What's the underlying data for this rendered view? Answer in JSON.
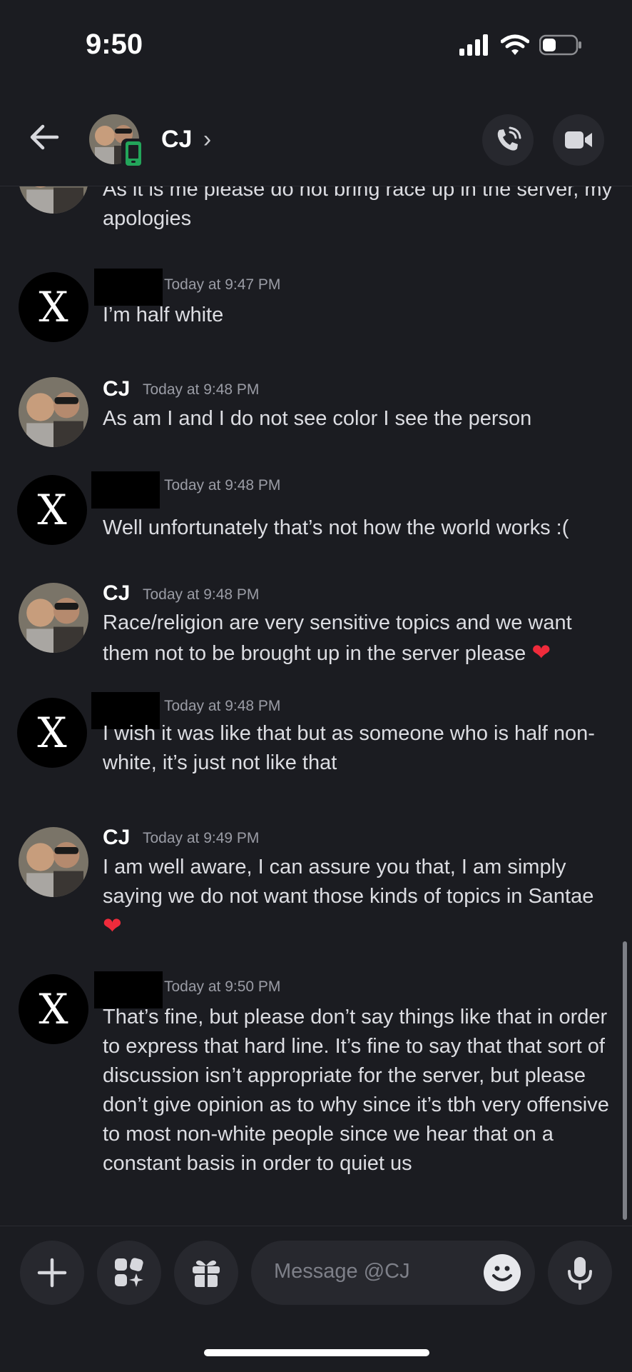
{
  "status_bar": {
    "time": "9:50"
  },
  "header": {
    "name": "CJ",
    "chevron": "›"
  },
  "composer": {
    "placeholder": "Message @CJ"
  },
  "messages": [
    {
      "author": "",
      "time": "",
      "text": "As it is me please do not bring race up in the server, my apologies"
    },
    {
      "author": "",
      "time": "Today at 9:47 PM",
      "text": "I’m half white"
    },
    {
      "author": "CJ",
      "time": "Today at 9:48 PM",
      "text": "As am I and I do not see color I see the person"
    },
    {
      "author": "",
      "time": "Today at 9:48 PM",
      "text": "Well unfortunately that’s not how the world works :("
    },
    {
      "author": "CJ",
      "time": "Today at 9:48 PM",
      "text": "Race/religion are very sensitive topics and we want them not to be brought up in the server please",
      "emoji": "❤"
    },
    {
      "author": "",
      "time": "Today at 9:48 PM",
      "text": "I wish it was like that but as someone who is half non-white, it’s just not like that"
    },
    {
      "author": "CJ",
      "time": "Today at 9:49 PM",
      "text": "I am well aware, I can assure you that, I am simply saying we do not want those kinds of topics in Santae",
      "emoji": "❤"
    },
    {
      "author": "",
      "time": "Today at 9:50 PM",
      "text": "That’s fine, but please don’t say things like that in order to express that hard line. It’s fine to say that that sort of discussion isn’t appropriate for the server, but please don’t give opinion as to why since it’s tbh very offensive to most non-white people since we hear that on a constant basis in order to quiet us"
    }
  ],
  "x_avatar_letter": "X",
  "colors": {
    "background": "#1b1c21",
    "surface": "#27282e",
    "heart": "#ef2b3b",
    "timestamp": "#9a9ca5"
  },
  "icons": [
    "back-arrow-icon",
    "phone-icon",
    "video-camera-icon",
    "plus-icon",
    "apps-icon",
    "gift-icon",
    "emoji-icon",
    "microphone-icon",
    "signal-icon",
    "wifi-icon",
    "battery-icon",
    "mobile-status-icon"
  ]
}
